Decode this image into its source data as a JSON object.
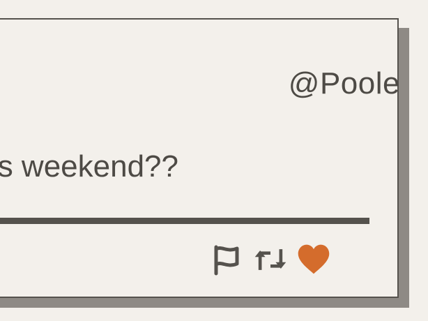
{
  "post": {
    "handle": "@Poole",
    "message": "s weekend??"
  },
  "actions": [
    {
      "name": "flag",
      "icon": "flag-icon",
      "color": "#55524d"
    },
    {
      "name": "repost",
      "icon": "repost-icon",
      "color": "#55524d"
    },
    {
      "name": "like",
      "icon": "heart-icon",
      "color": "#d46c2c"
    }
  ],
  "colors": {
    "background": "#f3f0eb",
    "border": "#55524d",
    "shadow": "#8e8a85",
    "accent": "#d46c2c",
    "text": "#4d4a45"
  }
}
